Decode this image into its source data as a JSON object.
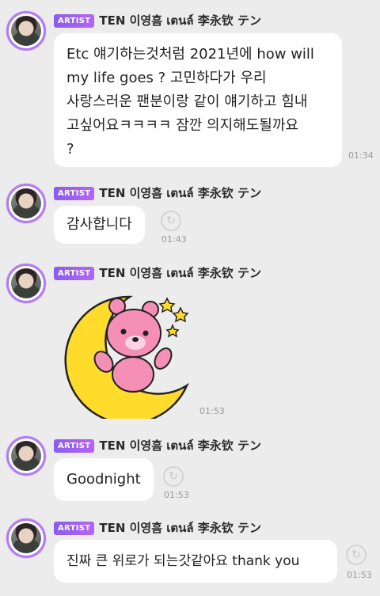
{
  "colors": {
    "background": "#ececec",
    "bubble": "#ffffff",
    "artist_badge": "#8a5cf0",
    "avatar_ring": "#b07cf0",
    "moon": "#ffdc2b",
    "bear": "#f58fb6",
    "timestamp": "#9a9a9a"
  },
  "messages": [
    {
      "badge": "ARTIST",
      "name": "TEN 이영흠 เตนล์ 李永钦 テン",
      "lines": [
        "Etc 얘기하는것처럼 2021년에 how will",
        "my life goes  ? 고민하다가 우리",
        "사랑스러운 팬분이랑 같이 얘기하고 힘내",
        "고싶어요ㅋㅋㅋㅋ 잠깐 의지해도될까요",
        "?"
      ],
      "time": "01:34",
      "icon": "reply-icon"
    },
    {
      "badge": "ARTIST",
      "name": "TEN 이영흠 เตนล์ 李永钦 テン",
      "text": "감사합니다",
      "time": "01:43",
      "icon": "reply-icon"
    },
    {
      "badge": "ARTIST",
      "name": "TEN 이영흠 เตนล์ 李永钦 テン",
      "sticker": "pink-bear-on-crescent-moon",
      "time": "01:53"
    },
    {
      "badge": "ARTIST",
      "name": "TEN 이영흠 เตนล์ 李永钦 テン",
      "text": "Goodnight",
      "time": "01:53",
      "icon": "reply-icon"
    },
    {
      "badge": "ARTIST",
      "name": "TEN 이영흠 เตนล์ 李永钦 テン",
      "text": "진짜 큰 위로가 되는갓같아요 thank you",
      "time": "01:53",
      "icon": "reply-icon"
    }
  ]
}
